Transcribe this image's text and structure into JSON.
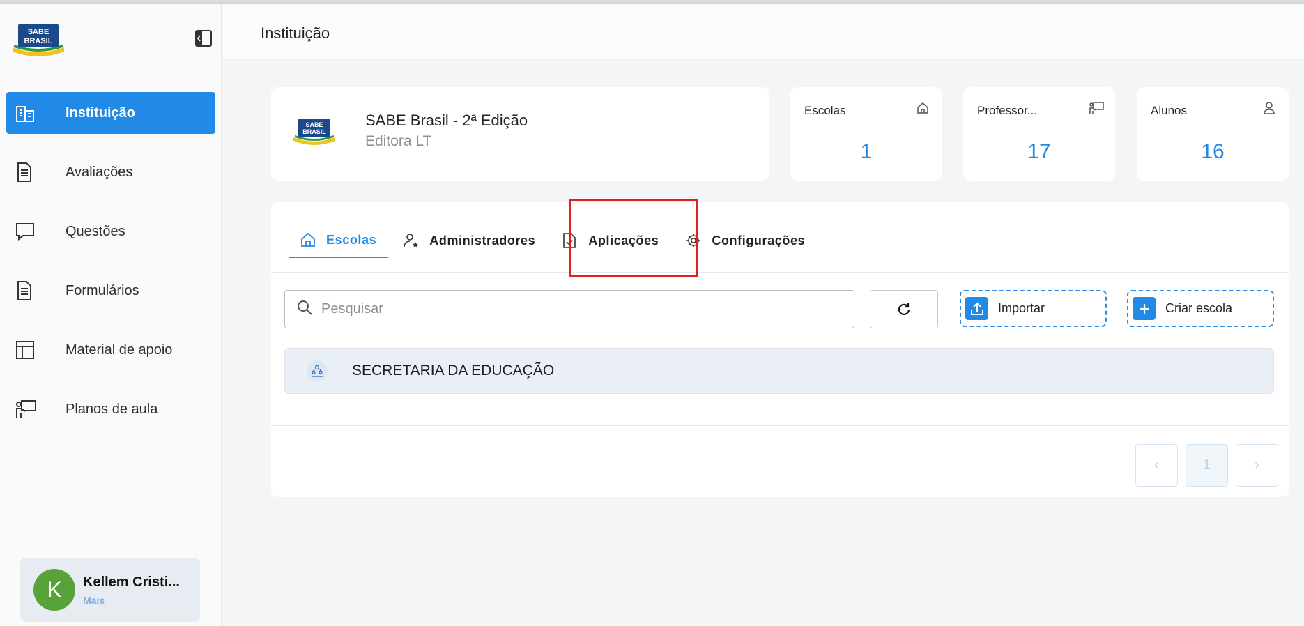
{
  "brand": {
    "logo_text_1": "SABE",
    "logo_text_2": "BRASIL"
  },
  "sidebar": {
    "items": [
      {
        "label": "Instituição",
        "icon": "building-icon",
        "active": true
      },
      {
        "label": "Avaliações",
        "icon": "document-icon"
      },
      {
        "label": "Questões",
        "icon": "comment-icon"
      },
      {
        "label": "Formulários",
        "icon": "form-icon"
      },
      {
        "label": "Material de apoio",
        "icon": "layout-icon"
      },
      {
        "label": "Planos de aula",
        "icon": "teacher-board-icon"
      }
    ],
    "user": {
      "initial": "K",
      "name": "Kellem Cristi...",
      "more": "Mais"
    }
  },
  "header": {
    "title": "Instituição"
  },
  "institution": {
    "name": "SABE Brasil - 2ª Edição",
    "publisher": "Editora LT"
  },
  "stats": [
    {
      "label": "Escolas",
      "value": "1",
      "icon": "home-icon"
    },
    {
      "label": "Professor...",
      "value": "17",
      "icon": "teacher-board-icon"
    },
    {
      "label": "Alunos",
      "value": "16",
      "icon": "user-icon"
    }
  ],
  "tabs": [
    {
      "label": "Escolas",
      "icon": "home-icon",
      "active": true
    },
    {
      "label": "Administradores",
      "icon": "user-star-icon"
    },
    {
      "label": "Aplicações",
      "icon": "file-check-icon"
    },
    {
      "label": "Configurações",
      "icon": "gear-icon"
    }
  ],
  "toolbar": {
    "search_placeholder": "Pesquisar",
    "import_label": "Importar",
    "create_label": "Criar escola"
  },
  "schools": [
    {
      "name": "SECRETARIA DA EDUCAÇÃO"
    }
  ],
  "pagination": {
    "current": "1",
    "prev": "‹",
    "next": "›"
  },
  "colors": {
    "accent": "#2189e6",
    "highlight": "#e02020",
    "avatar": "#58a337"
  }
}
